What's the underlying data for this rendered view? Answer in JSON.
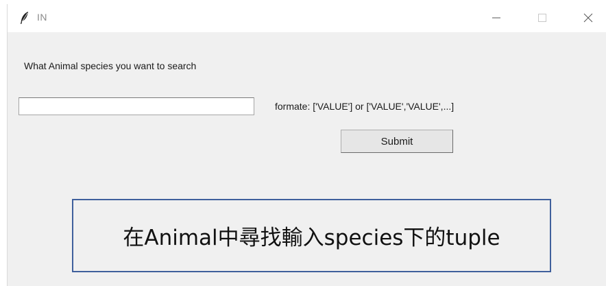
{
  "window": {
    "title": "IN",
    "icon": "feather-icon",
    "controls": [
      "minimize-icon",
      "maximize-icon",
      "close-icon"
    ]
  },
  "form": {
    "prompt": "What Animal species you want to search",
    "input_value": "",
    "format_hint": "formate: ['VALUE'] or ['VALUE','VALUE',...]",
    "submit_label": "Submit"
  },
  "annotation": {
    "text": "在Animal中尋找輸入species下的tuple",
    "border_color": "#3f5f9c"
  }
}
